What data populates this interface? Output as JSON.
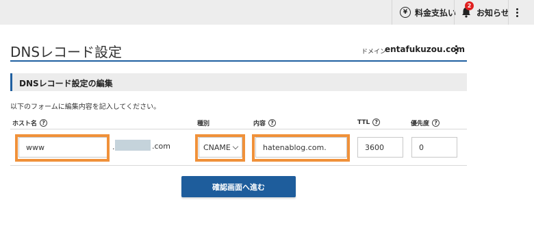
{
  "topbar": {
    "payment_label": "料金支払い",
    "notice_label": "お知らせ",
    "notice_badge": "2"
  },
  "header": {
    "title": "DNSレコード設定",
    "domain_label": "ドメイン",
    "domain_value": "entafukuzou.com"
  },
  "section": {
    "title": "DNSレコード設定の編集",
    "intro": "以下のフォームに編集内容を記入してください。"
  },
  "table": {
    "headers": {
      "host": "ホスト名",
      "type": "種別",
      "content": "内容",
      "ttl": "TTL",
      "priority": "優先度"
    },
    "row": {
      "host_value": "www",
      "host_dot": ".",
      "host_suffix": ".com",
      "type_value": "CNAME",
      "content_value": "hatenablog.com.",
      "ttl_value": "3600",
      "priority_value": "0"
    }
  },
  "actions": {
    "submit_label": "確認画面へ進む"
  },
  "colors": {
    "accent": "#1f5fa0",
    "highlight": "#f0913a",
    "badge": "#e02020"
  }
}
